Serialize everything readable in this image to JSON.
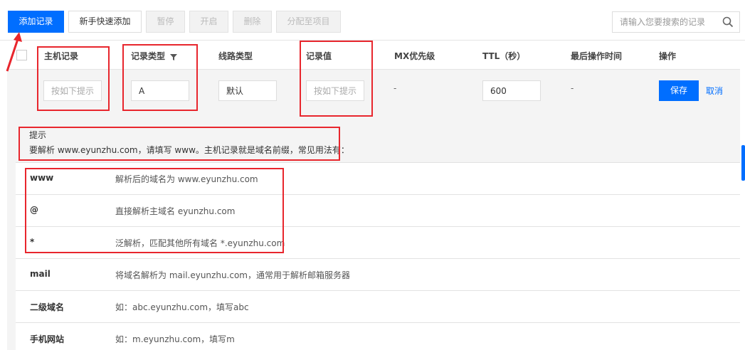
{
  "toolbar": {
    "add_record": "添加记录",
    "quick_add": "新手快速添加",
    "pause": "暂停",
    "enable": "开启",
    "delete": "删除",
    "assign_project": "分配至项目",
    "search_placeholder": "请输入您要搜索的记录",
    "search_icon": "search-icon"
  },
  "table": {
    "headers": {
      "host": "主机记录",
      "type": "记录类型",
      "line": "线路类型",
      "value": "记录值",
      "mx": "MX优先级",
      "ttl": "TTL（秒）",
      "last_op": "最后操作时间",
      "action": "操作"
    },
    "edit_row": {
      "host_placeholder": "按如下提示",
      "type_value": "A",
      "line_value": "默认",
      "value_placeholder": "按如下提示",
      "mx": "-",
      "ttl": "600",
      "last_op": "-",
      "save": "保存",
      "cancel": "取消"
    }
  },
  "tip": {
    "title": "提示",
    "description": "要解析 www.eyunzhu.com，请填写 www。主机记录就是域名前缀，常见用法有：",
    "rows": [
      {
        "key": "www",
        "desc": "解析后的域名为 www.eyunzhu.com"
      },
      {
        "key": "@",
        "desc": "直接解析主域名 eyunzhu.com"
      },
      {
        "key": "*",
        "desc": "泛解析，匹配其他所有域名 *.eyunzhu.com"
      },
      {
        "key": "mail",
        "desc": "将域名解析为 mail.eyunzhu.com，通常用于解析邮箱服务器"
      },
      {
        "key": "二级域名",
        "desc": "如：abc.eyunzhu.com，填写abc"
      },
      {
        "key": "手机网站",
        "desc": "如：m.eyunzhu.com，填写m"
      }
    ]
  },
  "colors": {
    "primary": "#006eff",
    "annotation": "#e8262d"
  }
}
